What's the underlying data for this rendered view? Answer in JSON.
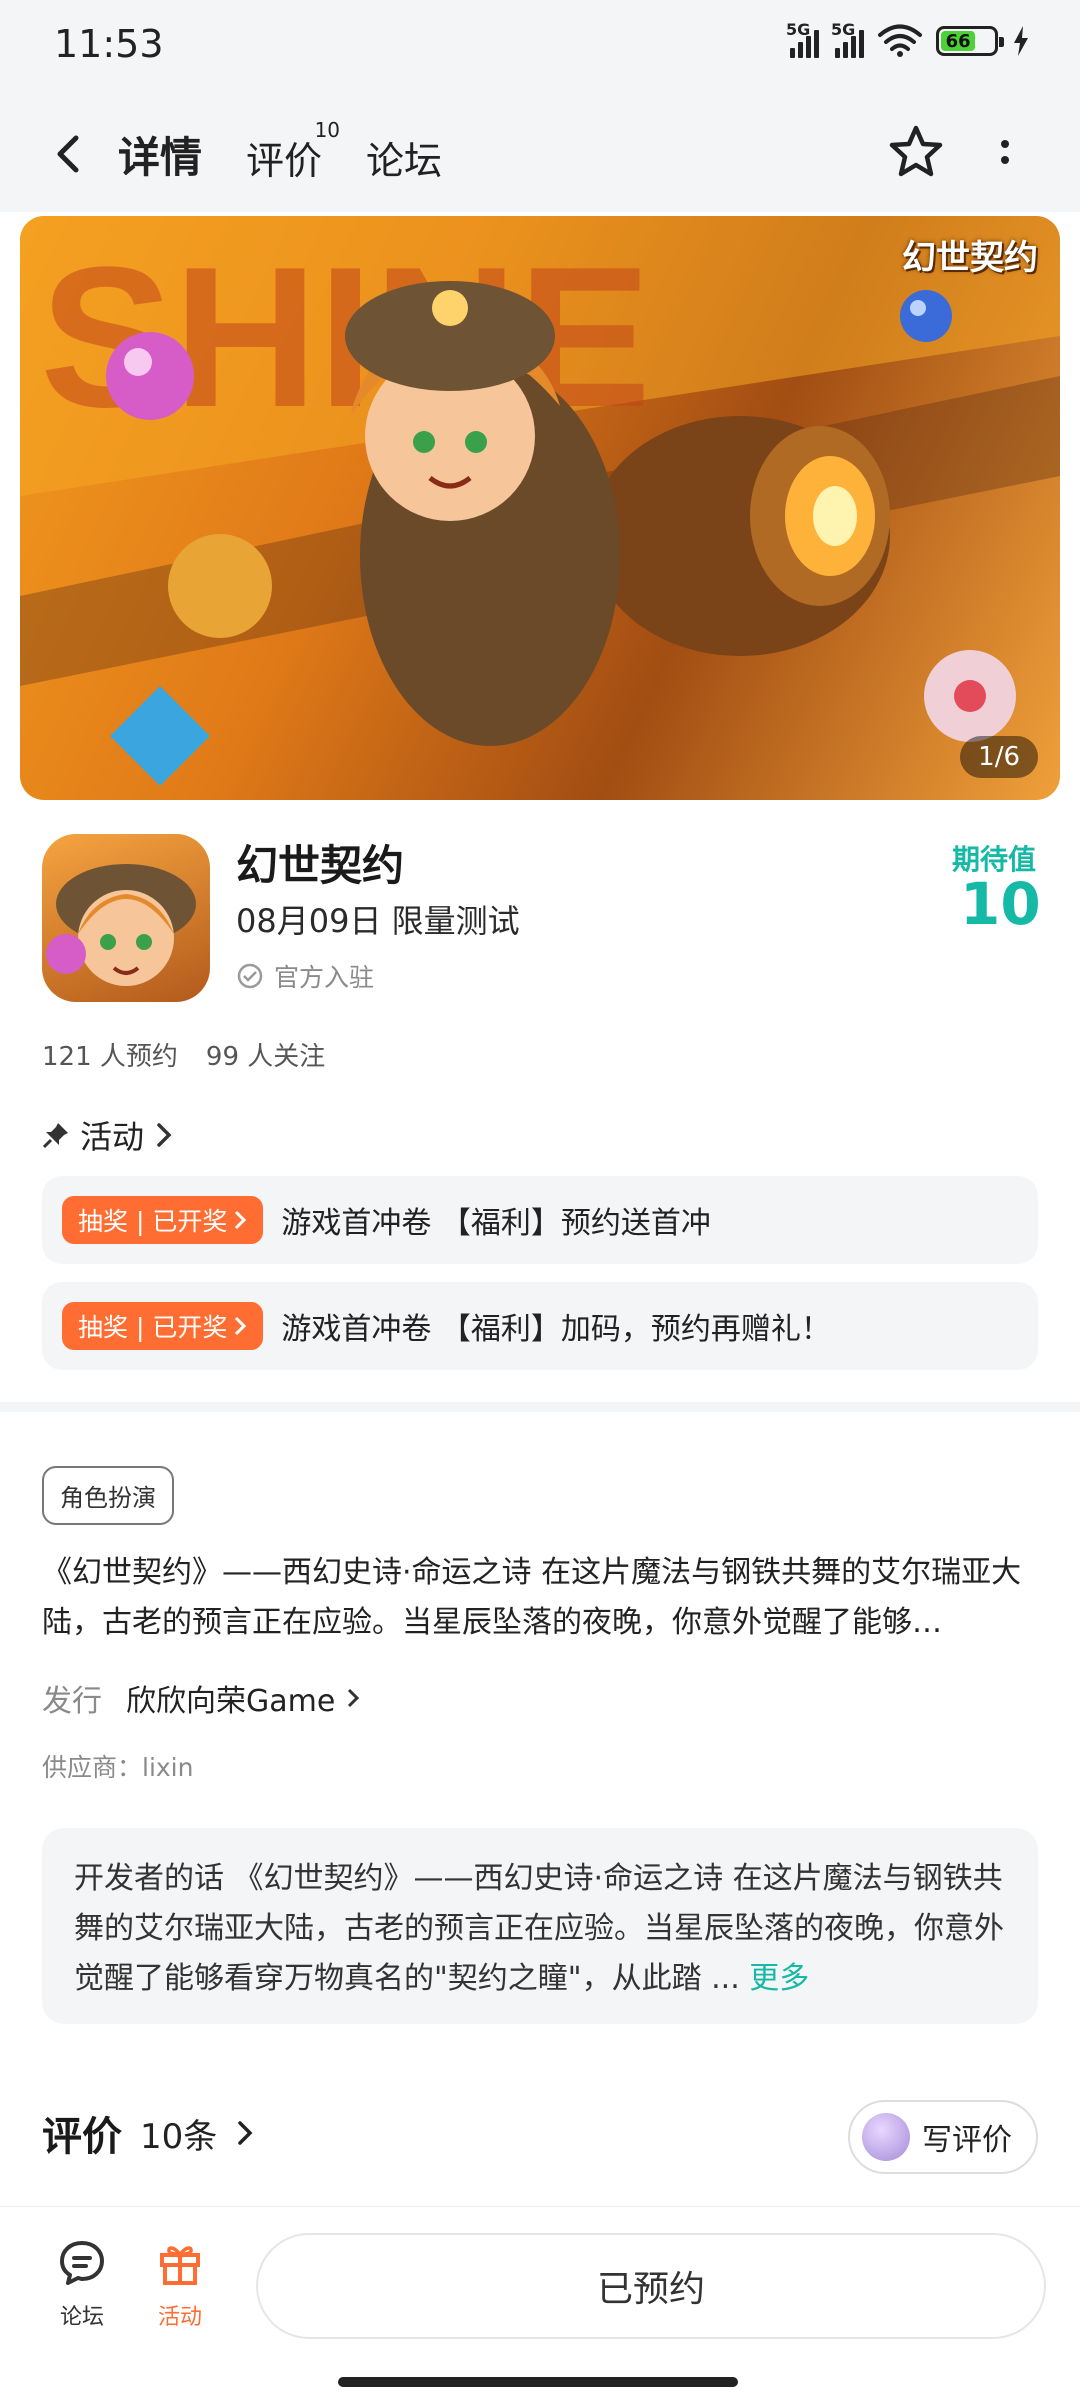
{
  "status_bar": {
    "time": "11:53",
    "battery": "66",
    "net1": "5G",
    "net2": "5G"
  },
  "header": {
    "tabs": [
      {
        "label": "详情"
      },
      {
        "label": "评价",
        "badge": "10"
      },
      {
        "label": "论坛"
      }
    ]
  },
  "banner": {
    "logo": "幻世契约",
    "counter": "1/6"
  },
  "app": {
    "name": "幻世契约",
    "date_info": "08月09日 限量测试",
    "verified": "官方入驻",
    "expect_label": "期待值",
    "expect_value": "10"
  },
  "stats": {
    "reserved": "121 人预约",
    "followers": "99 人关注"
  },
  "activity": {
    "title": "活动",
    "items": [
      {
        "badge": "抽奖 | 已开奖",
        "text": "游戏首冲卷 【福利】预约送首冲"
      },
      {
        "badge": "抽奖 | 已开奖",
        "text": "游戏首冲卷 【福利】加码，预约再赠礼！"
      }
    ]
  },
  "details": {
    "genre": "角色扮演",
    "description": "《幻世契约》——西幻史诗·命运之诗 在这片魔法与钢铁共舞的艾尔瑞亚大陆，古老的预言正在应验。当星辰坠落的夜晚，你意外觉醒了能够…",
    "publisher_label": "发行",
    "publisher": "欣欣向荣Game",
    "supplier": "供应商：lixin",
    "dev_words": "开发者的话 《幻世契约》——西幻史诗·命运之诗 在这片魔法与钢铁共舞的艾尔瑞亚大陆，古老的预言正在应验。当星辰坠落的夜晚，你意外觉醒了能够看穿万物真名的\"契约之瞳\"，从此踏 ...",
    "more": "更多"
  },
  "reviews": {
    "title": "评价",
    "count": "10条",
    "write": "写评价"
  },
  "bottom": {
    "forum": "论坛",
    "activity": "活动",
    "reserve": "已预约"
  },
  "colors": {
    "accent": "#15b9a6",
    "orange": "#ff6d32"
  }
}
